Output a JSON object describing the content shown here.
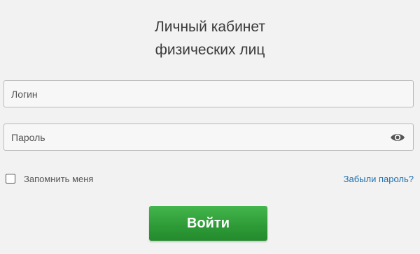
{
  "header": {
    "title_line1": "Личный кабинет",
    "title_line2": "физических лиц"
  },
  "form": {
    "login": {
      "placeholder": "Логин",
      "value": ""
    },
    "password": {
      "placeholder": "Пароль",
      "value": "",
      "toggle_icon": "eye-icon"
    },
    "remember": {
      "label": "Запомнить меня",
      "checked": false
    },
    "forgot_link": "Забыли пароль?",
    "submit_label": "Войти"
  },
  "colors": {
    "background": "#f2f2f2",
    "link": "#1c6fae",
    "button": "#2f9c38",
    "button_text": "#ffffff"
  }
}
